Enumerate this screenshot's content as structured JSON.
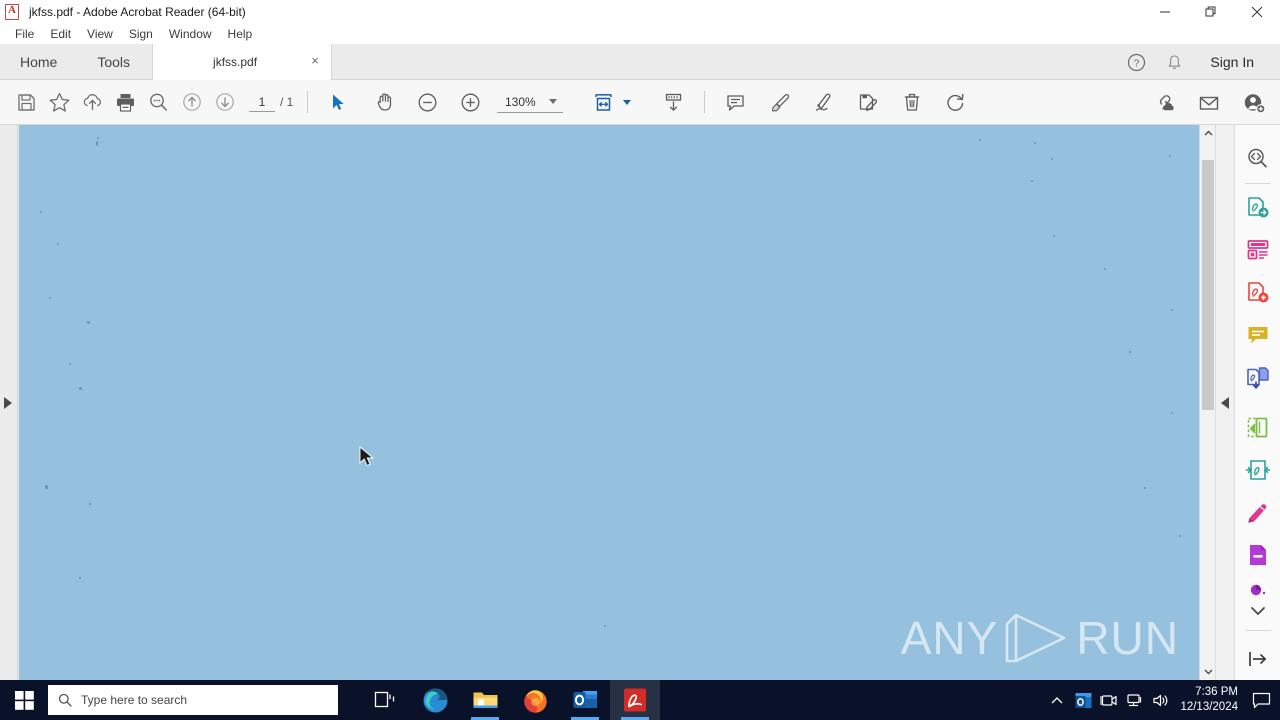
{
  "window": {
    "title": "jkfss.pdf - Adobe Acrobat Reader (64-bit)",
    "app_icon": "acrobat-icon",
    "controls": {
      "minimize": "minimize-icon",
      "restore": "restore-icon",
      "close": "close-icon"
    }
  },
  "menubar": {
    "items": [
      {
        "label": "File"
      },
      {
        "label": "Edit"
      },
      {
        "label": "View"
      },
      {
        "label": "Sign"
      },
      {
        "label": "Window"
      },
      {
        "label": "Help"
      }
    ]
  },
  "tabbar": {
    "home": "Home",
    "tools": "Tools",
    "document_tab": "jkfss.pdf",
    "close_glyph": "×",
    "help_icon": "help-circle-icon",
    "bell_icon": "notification-bell-icon",
    "sign_in": "Sign In"
  },
  "toolbar": {
    "save": "save-icon",
    "star": "add-to-favorites-icon",
    "upload": "cloud-upload-icon",
    "print": "print-icon",
    "find": "find-text-icon",
    "prev_page": "previous-page-icon",
    "next_page": "next-page-icon",
    "page_number": "1",
    "page_total": "/ 1",
    "select_tool": "select-cursor-icon",
    "hand_tool": "hand-pan-icon",
    "zoom_out": "zoom-out-icon",
    "zoom_in": "zoom-in-icon",
    "zoom_level": "130%",
    "fit_width": "fit-page-width-icon",
    "scroll_mode": "page-scrolling-icon",
    "comment": "add-comment-icon",
    "highlight": "highlight-text-icon",
    "draw": "draw-freehand-icon",
    "fill_sign": "fill-and-sign-icon",
    "delete": "delete-icon",
    "rotate": "rotate-page-icon",
    "share_link": "share-link-icon",
    "email": "email-icon",
    "add_person": "invite-person-icon"
  },
  "right_rail": {
    "items": [
      {
        "name": "search-tool",
        "color": "#5b5b5b"
      },
      {
        "name": "export-pdf-tool",
        "color": "#2ba39a"
      },
      {
        "name": "create-pdf-tool",
        "color": "#e0368c"
      },
      {
        "name": "combine-files-tool",
        "color": "#e8453c"
      },
      {
        "name": "comment-tool",
        "color": "#d9b321"
      },
      {
        "name": "organize-pages-tool",
        "color": "#4a62c4"
      },
      {
        "name": "crop-pages-tool",
        "color": "#7cc04a"
      },
      {
        "name": "compress-pdf-tool",
        "color": "#2ba39a"
      },
      {
        "name": "edit-pdf-tool",
        "color": "#e0368c"
      },
      {
        "name": "redact-tool",
        "color": "#b638d6"
      },
      {
        "name": "more-tools",
        "color": "#a32bc4"
      }
    ],
    "collapse": "collapse-panel-icon"
  },
  "document": {
    "background_color": "#95c1de",
    "left_pane_expand": "expand-navigation-pane-icon",
    "scroll_up": "scroll-up-icon",
    "scroll_down": "scroll-down-icon",
    "collapse_right": "collapse-tools-pane-icon",
    "watermark": {
      "left_text": "ANY",
      "right_text": "RUN",
      "logo": "anyrun-play-logo"
    },
    "cursor": "mouse-cursor"
  },
  "taskbar": {
    "start": "windows-start-icon",
    "search_placeholder": "Type here to search",
    "search_icon": "search-icon",
    "task_view": "task-view-icon",
    "apps": [
      {
        "name": "microsoft-edge",
        "running": false
      },
      {
        "name": "file-explorer",
        "running": true
      },
      {
        "name": "firefox",
        "running": false
      },
      {
        "name": "outlook",
        "running": true
      },
      {
        "name": "adobe-acrobat-reader",
        "running": true,
        "active": true
      }
    ],
    "tray": {
      "overflow": "show-hidden-icons-chevron",
      "outlook": "outlook-tray-icon",
      "camera": "camera-tray-icon",
      "network": "network-icon",
      "volume": "volume-icon",
      "time": "7:36 PM",
      "date": "12/13/2024",
      "action_center": "action-center-icon"
    }
  }
}
